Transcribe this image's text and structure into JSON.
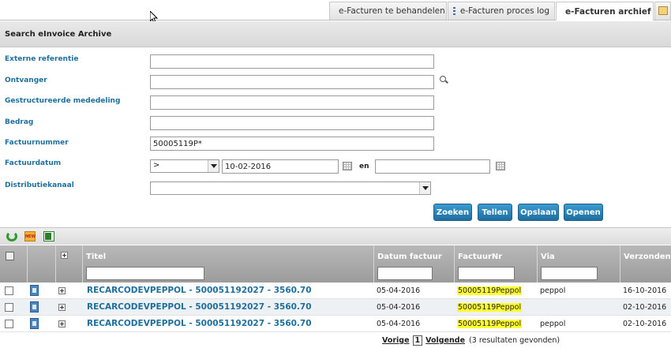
{
  "tabs": [
    {
      "label": "e-Facturen te behandelen",
      "icon": "gear-icon"
    },
    {
      "label": "e-Facturen proces log",
      "icon": "list-icon"
    },
    {
      "label": "e-Facturen archief",
      "icon": "archive-icon",
      "active": true
    }
  ],
  "search": {
    "title": "Search eInvoice Archive",
    "fields": {
      "externe_referentie": {
        "label": "Externe referentie",
        "value": ""
      },
      "ontvanger": {
        "label": "Ontvanger",
        "value": ""
      },
      "gestructureerde_mededeling": {
        "label": "Gestructureerde mededeling",
        "value": ""
      },
      "bedrag": {
        "label": "Bedrag",
        "value": ""
      },
      "factuurnummer": {
        "label": "Factuurnummer",
        "value": "50005119P*"
      },
      "factuurdatum": {
        "label": "Factuurdatum",
        "operator": ">",
        "from": "10-02-2016",
        "and_label": "en",
        "to": ""
      },
      "distributiekanaal": {
        "label": "Distributiekanaal",
        "value": ""
      }
    },
    "buttons": {
      "zoeken": "Zoeken",
      "tellen": "Tellen",
      "opslaan": "Opslaan",
      "openen": "Openen"
    }
  },
  "table": {
    "columns": {
      "titel": "Titel",
      "datum_factuur": "Datum factuur",
      "factuurnr": "FactuurNr",
      "via": "Via",
      "verzonden": "Verzonden"
    },
    "rows": [
      {
        "titel": "RECARCODEVPEPPOL - 500051192027 - 3560.70",
        "datum": "05-04-2016",
        "factuurnr": "50005119Peppol",
        "via": "peppol",
        "verzonden": "16-10-2016"
      },
      {
        "titel": "RECARCODEVPEPPOL - 500051192027 - 3560.70",
        "datum": "05-04-2016",
        "factuurnr": "50005119Peppol",
        "via": "",
        "verzonden": "02-10-2016"
      },
      {
        "titel": "RECARCODEVPEPPOL - 500051192027 - 3560.70",
        "datum": "05-04-2016",
        "factuurnr": "50005119Peppol",
        "via": "peppol",
        "verzonden": "02-10-2016"
      }
    ]
  },
  "pager": {
    "prev": "Vorige",
    "current": "1",
    "next": "Volgende",
    "results": "(3 resultaten gevonden)"
  },
  "colors": {
    "accent": "#1f6f9e",
    "button": "#2a85bb",
    "highlight": "#ffff33"
  }
}
